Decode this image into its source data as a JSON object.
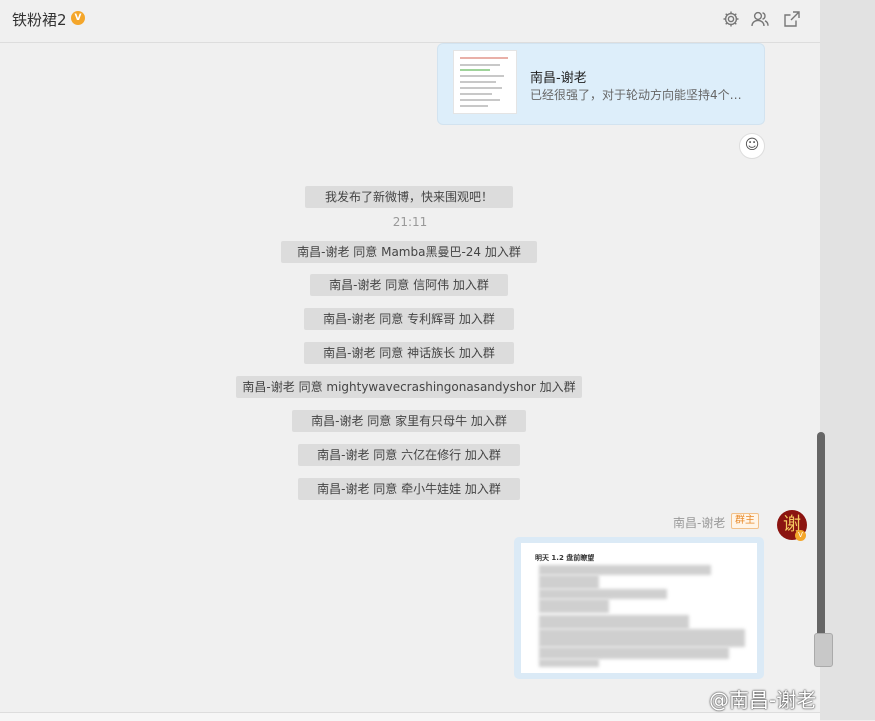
{
  "header": {
    "title": "铁粉裙2",
    "title_badge": "V",
    "icons": [
      "gear-icon",
      "group-members-icon",
      "open-external-icon"
    ]
  },
  "messages": {
    "link_card": {
      "title": "南昌-谢老",
      "desc": "已经很强了，对于轮动方向能坚持4个…"
    },
    "emoji_button_icon": "emoji-add-icon",
    "system_1": "我发布了新微博，快来围观吧！",
    "time": "21:11",
    "joins": [
      "南昌-谢老 同意 Mamba黑曼巴-24 加入群",
      "南昌-谢老 同意 信阿伟 加入群",
      "南昌-谢老 同意 专利辉哥 加入群",
      "南昌-谢老 同意 神话族长 加入群",
      "南昌-谢老 同意 mightywavecrashingonasandyshor 加入群",
      "南昌-谢老 同意 家里有只母牛 加入群",
      "南昌-谢老 同意 六亿在修行 加入群",
      "南昌-谢老 同意 牵小牛娃娃 加入群"
    ],
    "sender": {
      "name": "南昌-谢老",
      "badge": "群主",
      "avatar_char": "谢",
      "avatar_badge": "V"
    },
    "image_caption": "明天 1.2 盘前瞭望"
  },
  "watermark": "@南昌-谢老",
  "colors": {
    "background": "#f0f0f0",
    "link_card_bg": "#ddeefa",
    "system_bubble": "#dcdcdc",
    "owner_badge": "#e88a2a",
    "avatar_bg": "#8b1410",
    "verified_badge": "#f4a62a"
  }
}
